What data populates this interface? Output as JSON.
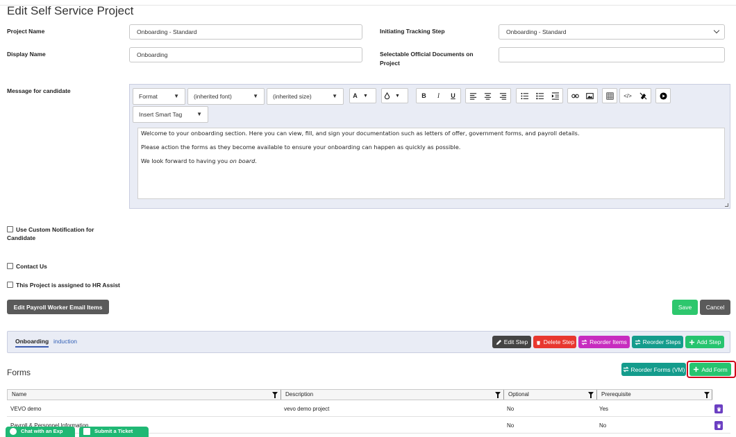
{
  "page": {
    "title": "Edit Self Service Project"
  },
  "form": {
    "project_name_label": "Project Name",
    "project_name_value": "Onboarding - Standard",
    "display_name_label": "Display Name",
    "display_name_value": "Onboarding",
    "initiating_step_label": "Initiating Tracking Step",
    "initiating_step_value": "Onboarding - Standard",
    "selectable_docs_label": "Selectable Official Documents on Project",
    "selectable_docs_value": "",
    "message_label": "Message for candidate"
  },
  "editor": {
    "format_select": "Format",
    "font_select": "(inherited font)",
    "size_select": "(inherited size)",
    "smart_tag_select": "Insert Smart Tag",
    "toolbar_icons": [
      "text-color",
      "background-color",
      "bold",
      "italic",
      "underline",
      "align-left",
      "align-center",
      "align-right",
      "bulleted-list",
      "numbered-list",
      "indent",
      "link",
      "image",
      "table",
      "code-view",
      "clear-format",
      "video"
    ],
    "paragraphs": [
      "Welcome to your onboarding section. Here you can view, fill, and sign your documentation such as letters of offer, government forms, and payroll details.",
      "Please action the forms as they become available to ensure your onboarding can happen as quickly as possible."
    ],
    "p3_prefix": "We look forward to having you ",
    "p3_italic": "on board",
    "p3_suffix": "."
  },
  "checkboxes": {
    "custom_notification_line1": "Use Custom Notification for",
    "custom_notification_line2": "Candidate",
    "contact_us": "Contact Us",
    "hr_assist": "This Project is assigned to HR Assist"
  },
  "actions": {
    "edit_payroll": "Edit Payroll Worker Email Items",
    "save": "Save",
    "cancel": "Cancel"
  },
  "steps": {
    "tabs": [
      "Onboarding",
      "induction"
    ],
    "edit_step": "Edit Step",
    "delete_step": "Delete Step",
    "reorder_items": "Reorder Items",
    "reorder_steps": "Reorder Steps",
    "add_step": "Add Step"
  },
  "forms": {
    "title": "Forms",
    "reorder_forms": "Reorder Forms (VM)",
    "add_form": "Add Form",
    "columns": [
      "Name",
      "Description",
      "Optional",
      "Prerequisite"
    ],
    "rows": [
      {
        "name": "VEVO demo",
        "description": "vevo demo project",
        "optional": "No",
        "prerequisite": "Yes"
      },
      {
        "name": "Payroll & Personnel Information",
        "description": "",
        "optional": "No",
        "prerequisite": "No"
      }
    ]
  },
  "footer": {
    "chat": "Chat with an Exp",
    "ticket": "Submit a Ticket"
  },
  "colors": {
    "edit_step": "#444444",
    "delete_step": "#e8372f",
    "reorder_items": "#c72cbf",
    "reorder_teal": "#149c8c",
    "add_green": "#26c46f",
    "save_green": "#2dc76d",
    "cancel": "#5a5a5a",
    "highlight": "#d0021b"
  }
}
